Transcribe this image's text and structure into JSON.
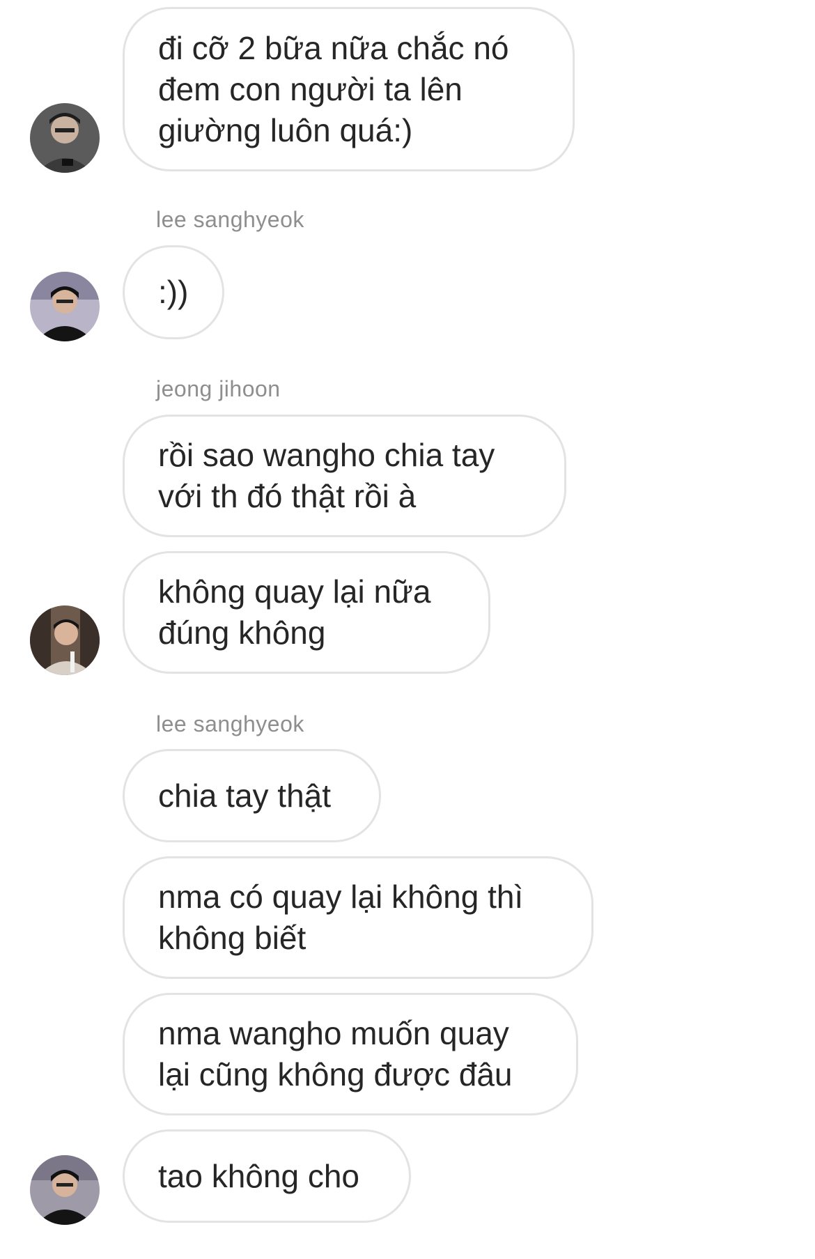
{
  "conversation": {
    "messages": [
      {
        "text": "đi cỡ 2 bữa nữa chắc nó\nđem con người ta lên\ngiường luôn quá:)"
      },
      {
        "text": ":))"
      },
      {
        "text": "rồi sao wangho chia tay\nvới th đó thật rồi à"
      },
      {
        "text": "không quay lại nữa\nđúng không"
      },
      {
        "text": "chia tay thật"
      },
      {
        "text": "nma có quay lại không thì\nkhông biết"
      },
      {
        "text": "nma wangho muốn quay\nlại cũng không được đâu"
      },
      {
        "text": "tao không cho"
      }
    ],
    "senders": [
      {
        "name": "lee sanghyeok"
      },
      {
        "name": "jeong jihoon"
      },
      {
        "name": "lee sanghyeok"
      }
    ]
  },
  "colors": {
    "bubble_border": "#e3e3e3",
    "text": "#262626",
    "sender_name": "#8e8e8e",
    "background": "#ffffff"
  }
}
